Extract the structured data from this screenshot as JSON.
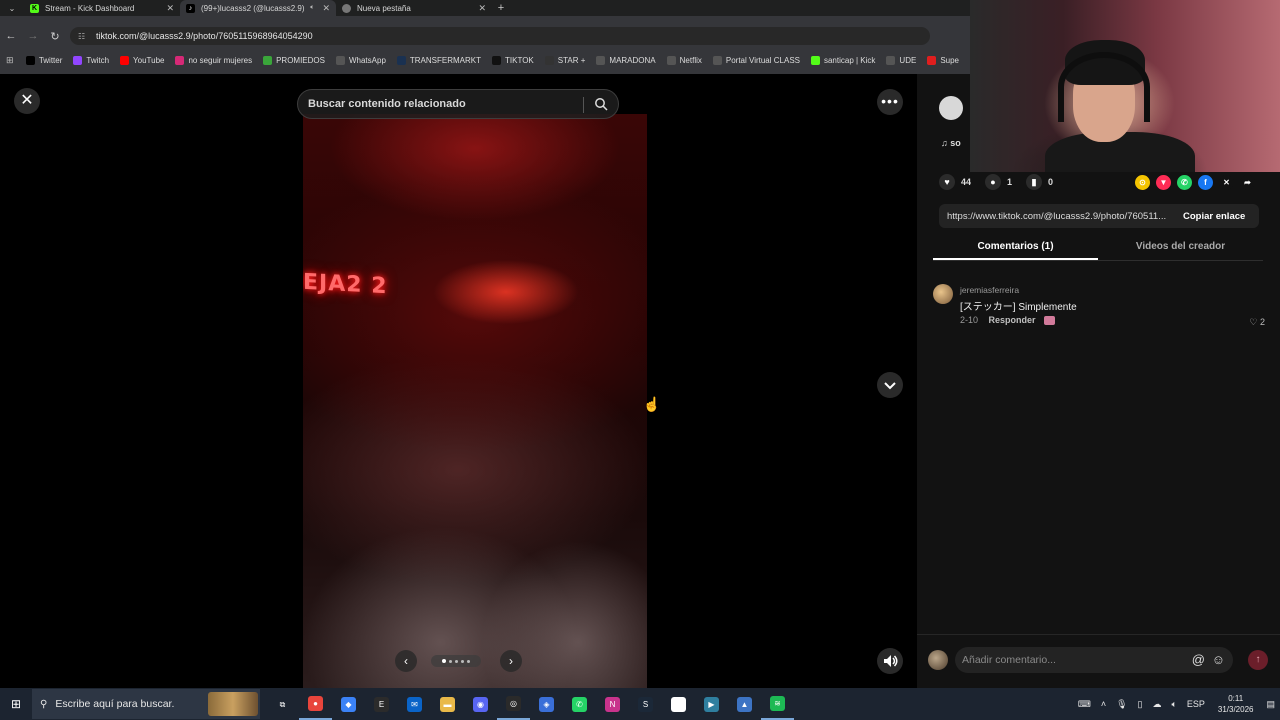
{
  "browser": {
    "tabs": [
      {
        "title": "Stream - Kick Dashboard",
        "icon": "kick-icon",
        "color": "#53fc18",
        "active": false
      },
      {
        "title": "(99+)lucasss2 (@lucasss2.9)",
        "icon": "tiktok-icon",
        "color": "#ffffff",
        "active": true
      },
      {
        "title": "Nueva pestaña",
        "icon": "chrome-icon",
        "color": "#bbbbbb",
        "active": false
      }
    ],
    "url": "tiktok.com/@lucasss2.9/photo/7605115968964054290",
    "bookmarks": [
      {
        "label": "Twitter",
        "icon": "x-icon",
        "color": "#000000"
      },
      {
        "label": "Twitch",
        "icon": "twitch-icon",
        "color": "#9146ff"
      },
      {
        "label": "YouTube",
        "icon": "youtube-icon",
        "color": "#ff0000"
      },
      {
        "label": "no seguir mujeres",
        "icon": "instagram-icon",
        "color": "#d62976"
      },
      {
        "label": "PROMIEDOS",
        "icon": "promiedos-icon",
        "color": "#3aa63a"
      },
      {
        "label": "WhatsApp",
        "icon": "globe-icon",
        "color": "#555555"
      },
      {
        "label": "TRANSFERMARKT",
        "icon": "transfermarkt-icon",
        "color": "#1a3151"
      },
      {
        "label": "TIKTOK",
        "icon": "tiktok-icon",
        "color": "#111111"
      },
      {
        "label": "STAR +",
        "icon": "star-icon",
        "color": "#333333"
      },
      {
        "label": "MARADONA",
        "icon": "globe-icon",
        "color": "#555555"
      },
      {
        "label": "Netflix",
        "icon": "globe-icon",
        "color": "#555555"
      },
      {
        "label": "Portal Virtual CLASS",
        "icon": "globe-icon",
        "color": "#555555"
      },
      {
        "label": "santicap | Kick",
        "icon": "kick-icon",
        "color": "#53fc18"
      },
      {
        "label": "UDE",
        "icon": "globe-icon",
        "color": "#555555"
      },
      {
        "label": "Supe",
        "icon": "super-icon",
        "color": "#e01e1e"
      }
    ]
  },
  "viewer": {
    "search_placeholder": "Buscar contenido relacionado",
    "neon_text": "EJA2 2",
    "carousel_dots": 5,
    "carousel_active": 1
  },
  "panel": {
    "music_label": "so",
    "likes": "44",
    "comments_count": "1",
    "saves": "0",
    "share_icons": [
      {
        "icon": "embed-icon",
        "color": "#f5c400",
        "glyph": "⊙"
      },
      {
        "icon": "send-icon",
        "color": "#fe2c55",
        "glyph": "▼"
      },
      {
        "icon": "whatsapp-icon",
        "color": "#25d366",
        "glyph": "✆"
      },
      {
        "icon": "facebook-icon",
        "color": "#1877f2",
        "glyph": "f"
      },
      {
        "icon": "x-icon",
        "color": "#121212",
        "glyph": "✕"
      },
      {
        "icon": "share-arrow-icon",
        "color": "#121212",
        "glyph": "➦"
      }
    ],
    "link_url": "https://www.tiktok.com/@lucasss2.9/photo/760511...",
    "copy_label": "Copiar enlace",
    "tab_comments": "Comentarios (1)",
    "tab_videos": "Videos del creador",
    "comment": {
      "user": "jeremiasferreira",
      "text": "[ステッカー] Simplemente",
      "date": "2-10",
      "reply": "Responder",
      "likes": "2"
    },
    "add_comment_placeholder": "Añadir comentario..."
  },
  "taskbar": {
    "search_placeholder": "Escribe aquí para buscar.",
    "apps": [
      {
        "icon": "task-view-icon",
        "color": "transparent",
        "glyph": "⧉"
      },
      {
        "icon": "chrome-icon",
        "color": "#e8453c",
        "glyph": "●",
        "open": true
      },
      {
        "icon": "copilot-icon",
        "color": "#3b82f6",
        "glyph": "◆"
      },
      {
        "icon": "epic-games-icon",
        "color": "#2b2b2b",
        "glyph": "E"
      },
      {
        "icon": "mail-icon",
        "color": "#0a64c8",
        "glyph": "✉"
      },
      {
        "icon": "file-explorer-icon",
        "color": "#e9b949",
        "glyph": "▬"
      },
      {
        "icon": "discord-icon",
        "color": "#5865f2",
        "glyph": "◉"
      },
      {
        "icon": "obs-icon",
        "color": "#2a2a2a",
        "glyph": "◎",
        "open": true
      },
      {
        "icon": "app-icon",
        "color": "#3a6fd8",
        "glyph": "◈"
      },
      {
        "icon": "whatsapp-icon",
        "color": "#25d366",
        "glyph": "✆"
      },
      {
        "icon": "onenote-icon",
        "color": "#c8338c",
        "glyph": "N"
      },
      {
        "icon": "steam-icon",
        "color": "#1b2838",
        "glyph": "S"
      },
      {
        "icon": "capcut-icon",
        "color": "#ffffff",
        "glyph": "▣"
      },
      {
        "icon": "app2-icon",
        "color": "#2f7f9f",
        "glyph": "▶"
      },
      {
        "icon": "malwarebytes-icon",
        "color": "#3d74c4",
        "glyph": "▲"
      },
      {
        "icon": "spotify-icon",
        "color": "#1db954",
        "glyph": "≋",
        "open": true
      }
    ],
    "language": "ESP",
    "time": "0:11",
    "date": "31/3/2026"
  }
}
